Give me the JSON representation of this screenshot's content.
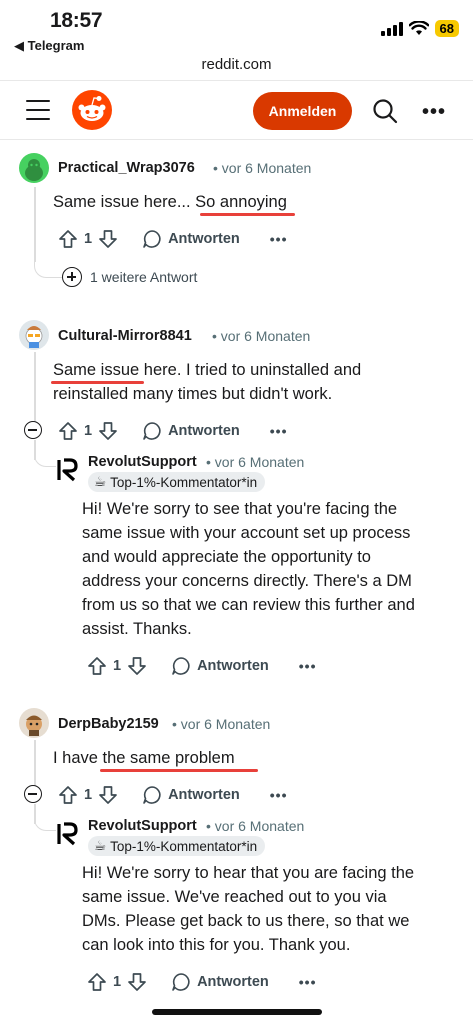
{
  "status_bar": {
    "time": "18:57",
    "back_app": "◀ Telegram",
    "battery": "68"
  },
  "browser": {
    "url": "reddit.com"
  },
  "navbar": {
    "login_label": "Anmelden",
    "more": "•••"
  },
  "comments": [
    {
      "author": "Practical_Wrap3076",
      "meta": "• vor 6 Monaten",
      "text": "Same issue here... So annoying",
      "votes": "1",
      "reply_label": "Antworten",
      "more_replies": "1 weitere Antwort"
    },
    {
      "author": "Cultural-Mirror8841",
      "meta": "• vor 6 Monaten",
      "text_line1": "Same issue here. I tried to uninstalled and",
      "text_line2": "reinstalled many times but didn't work.",
      "votes": "1",
      "reply_label": "Antworten",
      "reply": {
        "author": "RevolutSupport",
        "meta": "• vor 6 Monaten",
        "badge": "Top-1%-Kommentator*in",
        "lines": [
          "Hi! We're sorry to see that you're facing the",
          "same issue with your account set up process",
          "and would appreciate the opportunity to",
          "address your concerns directly. There's a DM",
          "from us so that we can review this further and",
          "assist. Thanks."
        ],
        "votes": "1",
        "reply_label": "Antworten"
      }
    },
    {
      "author": "DerpBaby2159",
      "meta": "• vor 6 Monaten",
      "text": "I have the same problem",
      "votes": "1",
      "reply_label": "Antworten",
      "reply": {
        "author": "RevolutSupport",
        "meta": "• vor 6 Monaten",
        "badge": "Top-1%-Kommentator*in",
        "lines": [
          "Hi! We're sorry to hear that you are facing the",
          "same issue. We've reached out to you via",
          "DMs. Please get back to us there, so that we",
          "can look into this for you. Thank you."
        ],
        "votes": "1",
        "reply_label": "Antworten"
      }
    }
  ],
  "colors": {
    "accent": "#d93900",
    "highlight": "#e8403a",
    "meta": "#576f76"
  },
  "icons": [
    "hamburger-icon",
    "reddit-logo",
    "search-icon",
    "upvote-icon",
    "downvote-icon",
    "comment-icon",
    "collapse-icon",
    "plus-icon",
    "revolut-logo",
    "cup-icon"
  ]
}
